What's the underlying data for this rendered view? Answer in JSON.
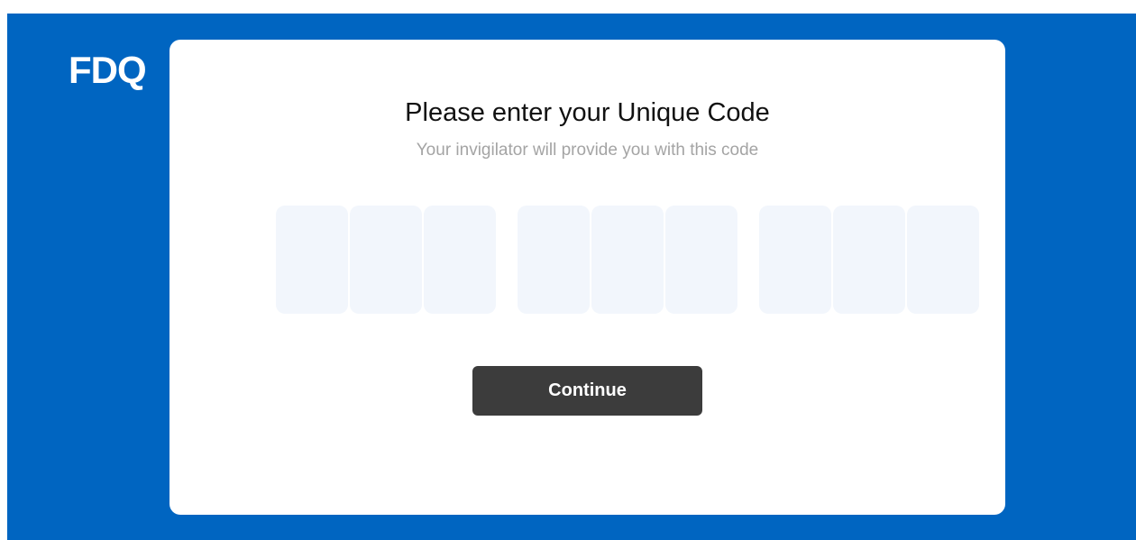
{
  "brand": {
    "logo_text": "FDQ",
    "background_color": "#0065c1"
  },
  "card": {
    "title": "Please enter your Unique Code",
    "subtitle": "Your invigilator will provide you with this code"
  },
  "code_input": {
    "groups": [
      [
        "",
        "",
        ""
      ],
      [
        "",
        "",
        ""
      ],
      [
        "",
        "",
        ""
      ]
    ],
    "box_color": "#f2f6fc"
  },
  "actions": {
    "continue_label": "Continue",
    "button_color": "#3c3c3c"
  }
}
